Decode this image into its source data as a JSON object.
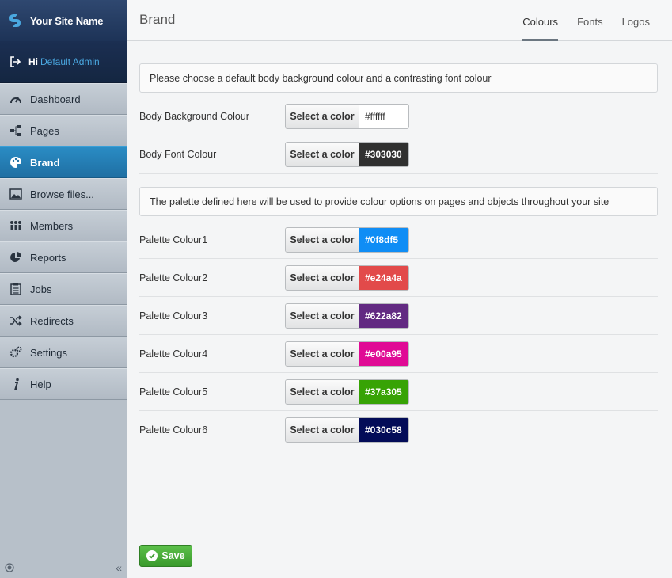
{
  "sidebar": {
    "site_name": "Your Site Name",
    "user_greeting": "Hi",
    "user_name": "Default Admin",
    "items": [
      {
        "label": "Dashboard",
        "icon": "gauge-icon"
      },
      {
        "label": "Pages",
        "icon": "sitemap-icon"
      },
      {
        "label": "Brand",
        "icon": "palette-icon"
      },
      {
        "label": "Browse files...",
        "icon": "image-icon"
      },
      {
        "label": "Members",
        "icon": "users-icon"
      },
      {
        "label": "Reports",
        "icon": "pie-chart-icon"
      },
      {
        "label": "Jobs",
        "icon": "clipboard-icon"
      },
      {
        "label": "Redirects",
        "icon": "shuffle-icon"
      },
      {
        "label": "Settings",
        "icon": "gears-icon"
      },
      {
        "label": "Help",
        "icon": "info-icon"
      }
    ],
    "active": "Brand",
    "collapse_glyph": "«"
  },
  "header": {
    "title": "Brand",
    "tabs": [
      "Colours",
      "Fonts",
      "Logos"
    ],
    "active_tab": "Colours"
  },
  "section1": {
    "info": "Please choose a default body background colour and a contrasting font colour",
    "rows": [
      {
        "label": "Body Background Colour",
        "button": "Select a color",
        "value": "#ffffff",
        "color": "#ffffff"
      },
      {
        "label": "Body Font Colour",
        "button": "Select a color",
        "value": "#303030",
        "color": "#303030"
      }
    ]
  },
  "section2": {
    "info": "The palette defined here will be used to provide colour options on pages and objects throughout your site",
    "rows": [
      {
        "label": "Palette Colour1",
        "button": "Select a color",
        "value": "#0f8df5",
        "color": "#0f8df5"
      },
      {
        "label": "Palette Colour2",
        "button": "Select a color",
        "value": "#e24a4a",
        "color": "#e24a4a"
      },
      {
        "label": "Palette Colour3",
        "button": "Select a color",
        "value": "#622a82",
        "color": "#622a82"
      },
      {
        "label": "Palette Colour4",
        "button": "Select a color",
        "value": "#e00a95",
        "color": "#e00a95"
      },
      {
        "label": "Palette Colour5",
        "button": "Select a color",
        "value": "#37a305",
        "color": "#37a305"
      },
      {
        "label": "Palette Colour6",
        "button": "Select a color",
        "value": "#030c58",
        "color": "#030c58"
      }
    ]
  },
  "footer": {
    "save_label": "Save"
  }
}
